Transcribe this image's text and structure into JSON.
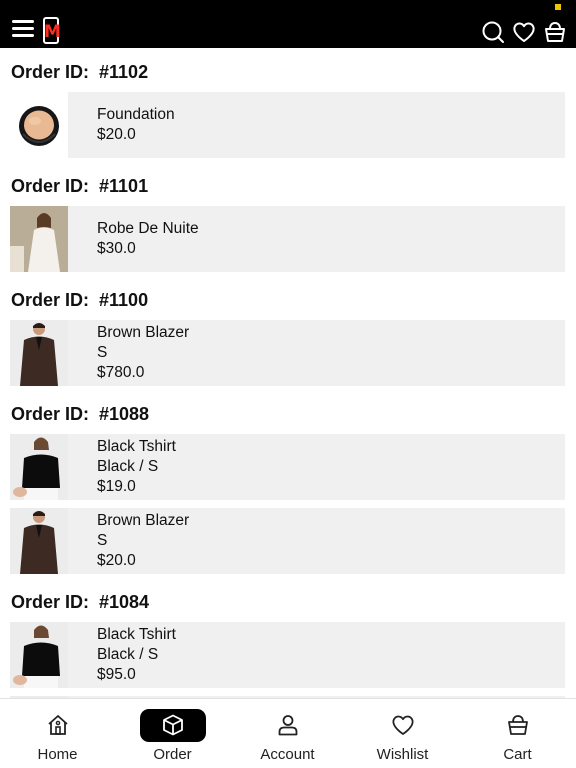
{
  "colors": {
    "topbar": "#000000",
    "accent": "#ff2d1f",
    "row_bg": "#f0f0f0",
    "nav_active": "#000000"
  },
  "header": {
    "logo_letter": "M",
    "icons": [
      "menu-icon",
      "search-icon",
      "heart-icon",
      "basket-icon"
    ]
  },
  "orders": [
    {
      "label": "Order ID:  #1102",
      "items": [
        {
          "lines": [
            "Foundation",
            "$20.0"
          ],
          "image": "compact-powder"
        }
      ]
    },
    {
      "label": "Order ID:  #1101",
      "items": [
        {
          "lines": [
            "Robe De Nuite",
            "$30.0"
          ],
          "image": "white-robe"
        }
      ]
    },
    {
      "label": "Order ID:  #1100",
      "items": [
        {
          "lines": [
            "Brown Blazer",
            "S",
            "$780.0"
          ],
          "image": "brown-blazer"
        }
      ]
    },
    {
      "label": "Order ID:  #1088",
      "items": [
        {
          "lines": [
            "Black Tshirt",
            "Black / S",
            "$19.0"
          ],
          "image": "black-tshirt"
        },
        {
          "lines": [
            "Brown Blazer",
            "S",
            "$20.0"
          ],
          "image": "brown-blazer"
        }
      ]
    },
    {
      "label": "Order ID:  #1084",
      "items": [
        {
          "lines": [
            "Black Tshirt",
            "Black / S",
            "$95.0"
          ],
          "image": "black-tshirt"
        }
      ]
    }
  ],
  "nav": {
    "home": "Home",
    "order": "Order",
    "account": "Account",
    "wishlist": "Wishlist",
    "cart": "Cart",
    "active": "Order"
  }
}
